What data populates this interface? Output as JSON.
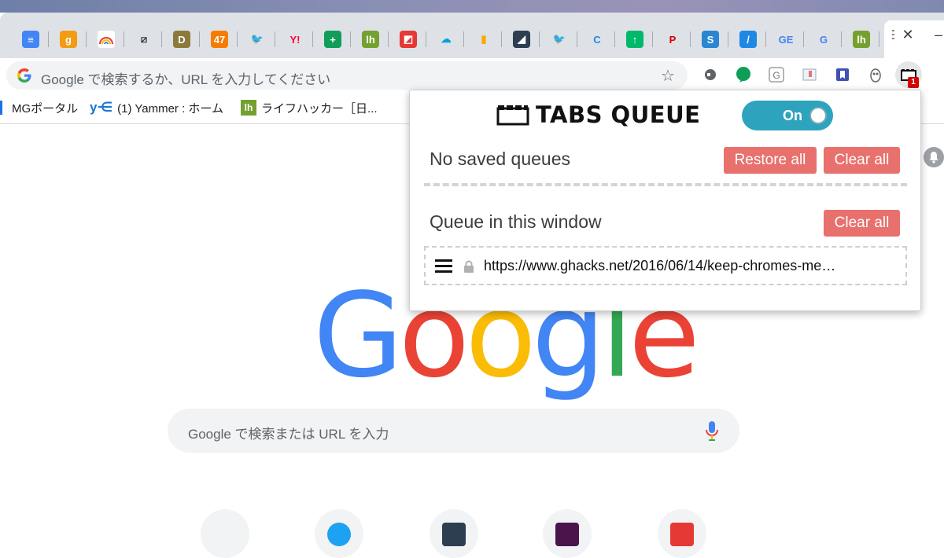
{
  "tabs": [
    {
      "icon": "google-docs-icon",
      "glyph": "≡",
      "bg": "#4285f4"
    },
    {
      "icon": "orange-g-icon",
      "glyph": "g",
      "bg": "#f39c12"
    },
    {
      "icon": "rainbow-icon",
      "glyph": "",
      "bg": "#ffffff"
    },
    {
      "icon": "diagonal-lines-icon",
      "glyph": "⧄",
      "bg": "#dee1e6"
    },
    {
      "icon": "d-icon",
      "glyph": "D",
      "bg": "#8b7a3a"
    },
    {
      "icon": "news47-icon",
      "glyph": "47",
      "bg": "#f57c00"
    },
    {
      "icon": "twitter-icon",
      "glyph": "🐦",
      "bg": "#dee1e6"
    },
    {
      "icon": "yahoo-icon",
      "glyph": "Y!",
      "bg": "#dee1e6"
    },
    {
      "icon": "green-plus-icon",
      "glyph": "+",
      "bg": "#0f9d58"
    },
    {
      "icon": "lifehacker-icon",
      "glyph": "lh",
      "bg": "#74a12e"
    },
    {
      "icon": "red-square-icon",
      "glyph": "◩",
      "bg": "#e53935"
    },
    {
      "icon": "salesforce-icon",
      "glyph": "☁",
      "bg": "#dee1e6"
    },
    {
      "icon": "analytics-icon",
      "glyph": "▮",
      "bg": "#dee1e6"
    },
    {
      "icon": "dark-blue-icon",
      "glyph": "◢",
      "bg": "#2c3e50"
    },
    {
      "icon": "twitter-icon",
      "glyph": "🐦",
      "bg": "#dee1e6"
    },
    {
      "icon": "blue-c-icon",
      "glyph": "C",
      "bg": "#dee1e6"
    },
    {
      "icon": "green-upload-icon",
      "glyph": "↑",
      "bg": "#00b96b"
    },
    {
      "icon": "playstation-icon",
      "glyph": "P",
      "bg": "#dee1e6"
    },
    {
      "icon": "blue-swirl-icon",
      "glyph": "S",
      "bg": "#2a86d1"
    },
    {
      "icon": "blue-slash-icon",
      "glyph": "/",
      "bg": "#1e88e5"
    },
    {
      "icon": "google-news-icon",
      "glyph": "GE",
      "bg": "#dee1e6"
    },
    {
      "icon": "google-icon",
      "glyph": "G",
      "bg": "#dee1e6"
    },
    {
      "icon": "lifehacker-icon",
      "glyph": "lh",
      "bg": "#74a12e"
    }
  ],
  "omnibox": {
    "placeholder": "Google で検索するか、URL を入力してください"
  },
  "bookmarks": [
    {
      "label": "MGポータル",
      "icon": "bar-icon"
    },
    {
      "label": "(1) Yammer : ホーム",
      "icon": "yammer-icon"
    },
    {
      "label": "ライフハッカー［日...",
      "icon": "lifehacker-icon"
    }
  ],
  "popup": {
    "title": "TABS QUEUE",
    "toggle_label": "On",
    "saved_heading": "No saved queues",
    "restore_all": "Restore all",
    "clear_all_saved": "Clear all",
    "window_heading": "Queue in this window",
    "clear_all_window": "Clear all",
    "queue": [
      {
        "url": "https://www.ghacks.net/2016/06/14/keep-chromes-me…"
      }
    ]
  },
  "extension_badge": "1",
  "google_logo": [
    "G",
    "o",
    "o",
    "g",
    "l",
    "e"
  ],
  "search": {
    "placeholder": "Google で検索または URL を入力"
  },
  "colors": {
    "accent": "#2ea3bd",
    "button": "#e8706d",
    "badge": "#d50000"
  }
}
